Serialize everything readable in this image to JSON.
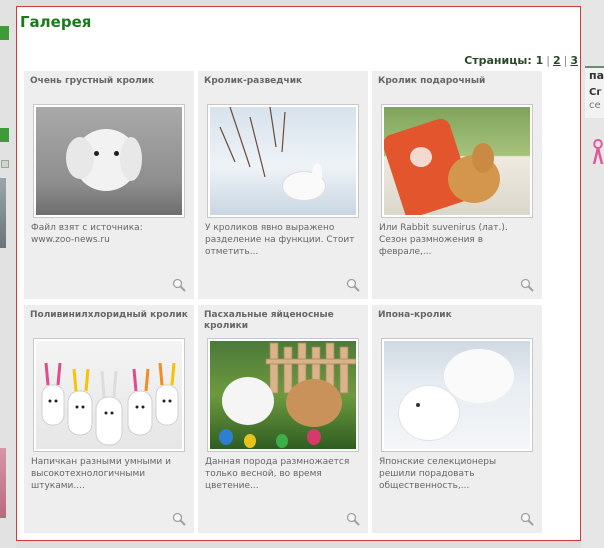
{
  "gallery": {
    "title": "Галерея",
    "pager_label": "Страницы:",
    "pages": [
      "1",
      "2",
      "3"
    ]
  },
  "items": [
    {
      "title": "Очень грустный кролик",
      "desc": "Файл взят с источника: www.zoo-news.ru"
    },
    {
      "title": "Кролик-разведчик",
      "desc": "У кроликов явно выражено разделение на функции. Стоит отметить..."
    },
    {
      "title": "Кролик подарочный",
      "desc": "Или Rabbit suvenirus (лат.). Сезон размножения в феврале,..."
    },
    {
      "title": "Поливинилхлоридный кролик",
      "desc": "Напичкан разными умными и высокотехнологичными штуками...."
    },
    {
      "title": "Пасхальные яйценосные кролики",
      "desc": "Данная порода размножается только весной, во время цветение..."
    },
    {
      "title": "Ипона-кролик",
      "desc": "Японские селекционеры решили порадовать общественность,..."
    }
  ],
  "sidebar_right": {
    "heading": "па",
    "line1": "Сг",
    "line2": "се"
  },
  "colors": {
    "title_green": "#1b7a1b",
    "border_red": "#d43a3a",
    "card_bg": "#eeeeee"
  },
  "icons": {
    "zoom": "magnifier-icon"
  }
}
